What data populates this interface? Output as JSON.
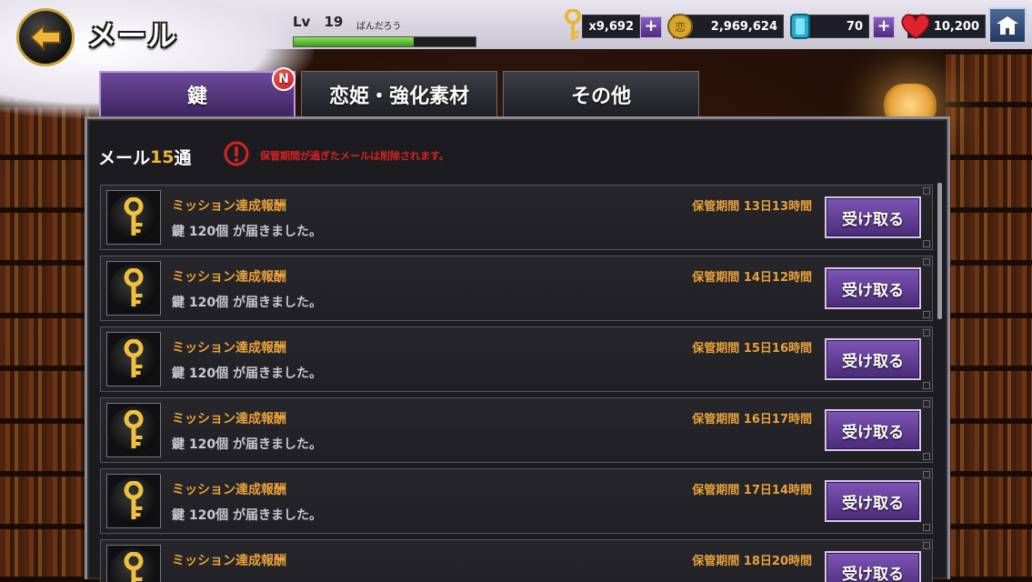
{
  "header": {
    "title": "メール",
    "level_label": "Lv",
    "level_value": "19",
    "player_name": "ばんだろう",
    "xp_fraction": 0.66
  },
  "resources": {
    "keys": "x9,692",
    "coins": "2,969,624",
    "gems": "70",
    "hearts": "10,200"
  },
  "tabs": [
    {
      "label": "鍵",
      "active": true,
      "badge": "N"
    },
    {
      "label": "恋姫・強化素材",
      "active": false
    },
    {
      "label": "その他",
      "active": false
    }
  ],
  "panel": {
    "mail_label": "メール",
    "mail_count": "15",
    "mail_unit": "通",
    "warning": "保管期間が過ぎたメールは削除されます。"
  },
  "mails": [
    {
      "title": "ミッション達成報酬",
      "desc": "鍵 120個 が届きました。",
      "expiry": "保管期間 13日13時間",
      "button": "受け取る"
    },
    {
      "title": "ミッション達成報酬",
      "desc": "鍵 120個 が届きました。",
      "expiry": "保管期間 14日12時間",
      "button": "受け取る"
    },
    {
      "title": "ミッション達成報酬",
      "desc": "鍵 120個 が届きました。",
      "expiry": "保管期間 15日16時間",
      "button": "受け取る"
    },
    {
      "title": "ミッション達成報酬",
      "desc": "鍵 120個 が届きました。",
      "expiry": "保管期間 16日17時間",
      "button": "受け取る"
    },
    {
      "title": "ミッション達成報酬",
      "desc": "鍵 120個 が届きました。",
      "expiry": "保管期間 17日14時間",
      "button": "受け取る"
    },
    {
      "title": "ミッション達成報酬",
      "desc": "",
      "expiry": "保管期間 18日20時間",
      "button": "受け取る"
    }
  ],
  "colors": {
    "accent_orange": "#e8a23a",
    "warning_red": "#d82222",
    "button_purple": "#6e4a9a"
  },
  "icons": {
    "back": "back-arrow-icon",
    "key": "key-icon",
    "coin": "coin-icon",
    "gem": "gem-icon",
    "heart": "heart-icon",
    "home": "home-icon",
    "warning": "warning-icon"
  }
}
